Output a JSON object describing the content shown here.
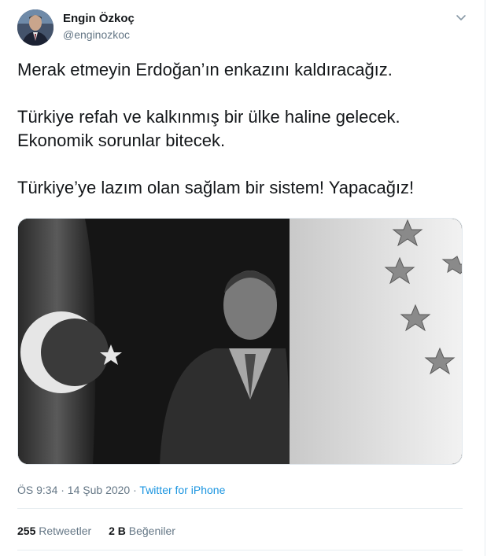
{
  "author": {
    "name": "Engin Özkoç",
    "handle": "@enginozkoc"
  },
  "tweet": {
    "line1": "Merak etmeyin Erdoğan’ın enkazını kaldıracağız.",
    "line2": "Türkiye refah ve kalkınmış bir ülke haline gelecek.",
    "line3": "Ekonomik sorunlar bitecek.",
    "line4": "Türkiye’ye lazım olan sağlam bir sistem! Yapacağız!"
  },
  "meta": {
    "timestamp": "ÖS 9:34 · 14 Şub 2020",
    "separator": "·",
    "source": "Twitter for iPhone"
  },
  "stats": {
    "retweets_count": "255",
    "retweets_label": "Retweetler",
    "likes_count": "2 B",
    "likes_label": "Beğeniler"
  },
  "icons": {
    "caret": "chevron-down-icon"
  },
  "colors": {
    "link": "#1b95e0",
    "secondary_text": "#657786",
    "primary_text": "#14171a"
  }
}
